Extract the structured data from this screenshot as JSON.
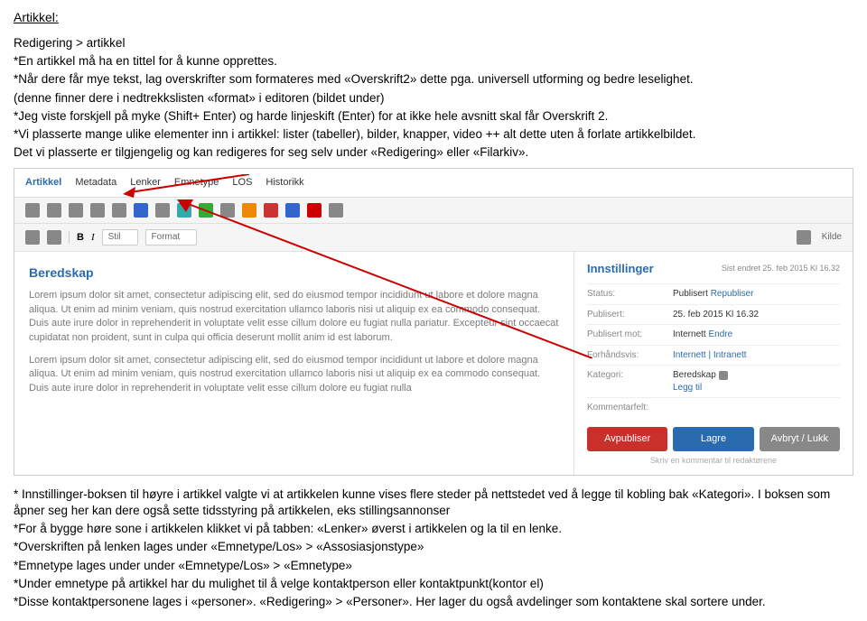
{
  "title": "Artikkel:",
  "intro": [
    "Redigering > artikkel",
    "*En artikkel må ha en tittel for å kunne opprettes.",
    "*Når dere får mye tekst, lag overskrifter som formateres med «Overskrift2» dette pga. universell utforming og bedre leselighet.",
    "(denne finner dere i nedtrekkslisten «format» i editoren (bildet under)",
    "*Jeg viste forskjell på myke (Shift+ Enter) og harde linjeskift (Enter) for at ikke hele avsnitt skal får Overskrift 2.",
    "*Vi plasserte mange ulike elementer inn i artikkel: lister (tabeller), bilder, knapper, video ++ alt dette uten å forlate artikkelbildet.",
    " Det vi plasserte er tilgjengelig og kan redigeres for seg selv under «Redigering» eller «Filarkiv»."
  ],
  "tabs": [
    "Artikkel",
    "Metadata",
    "Lenker",
    "Emnetype",
    "LOS",
    "Historikk"
  ],
  "toolbar2": {
    "b": "B",
    "i": "I",
    "sel1": "Stil",
    "sel2": "Format",
    "kilde": "Kilde"
  },
  "editor": {
    "heading": "Beredskap",
    "p1": "Lorem ipsum dolor sit amet, consectetur adipiscing elit, sed do eiusmod tempor incididunt ut labore et dolore magna aliqua. Ut enim ad minim veniam, quis nostrud exercitation ullamco laboris nisi ut aliquip ex ea commodo consequat. Duis aute irure dolor in reprehenderit in voluptate velit esse cillum dolore eu fugiat nulla pariatur. Excepteur sint occaecat cupidatat non proident, sunt in culpa qui officia deserunt mollit anim id est laborum.",
    "p2": "Lorem ipsum dolor sit amet, consectetur adipiscing elit, sed do eiusmod tempor incididunt ut labore et dolore magna aliqua. Ut enim ad minim veniam, quis nostrud exercitation ullamco laboris nisi ut aliquip ex ea commodo consequat. Duis aute irure dolor in reprehenderit in voluptate velit esse cillum dolore eu fugiat nulla"
  },
  "side": {
    "title": "Innstillinger",
    "sub": "Sist endret 25. feb 2015 Kl 16.32",
    "rows": [
      {
        "k": "Status:",
        "v": "Publisert",
        "link": "Republiser"
      },
      {
        "k": "Publisert:",
        "v": "25. feb 2015 Kl 16.32"
      },
      {
        "k": "Publisert mot:",
        "v": "Internett",
        "link": "Endre"
      },
      {
        "k": "Forhåndsvis:",
        "link": "Internett | Intranett"
      },
      {
        "k": "Kategori:",
        "v": "Beredskap",
        "extra": "Legg til",
        "icon": true
      },
      {
        "k": "Kommentarfelt:",
        "v": ""
      }
    ],
    "buttons": [
      "Avpubliser",
      "Lagre",
      "Avbryt / Lukk"
    ],
    "foot": "Skriv en kommentar til redaktørene"
  },
  "outro": [
    "* Innstillinger-boksen til høyre i artikkel valgte vi at artikkelen kunne vises flere steder på nettstedet ved å legge til kobling bak «Kategori». I boksen som åpner seg her kan dere også sette tidsstyring på artikkelen, eks stillingsannonser",
    "   *For å bygge høre sone i artikkelen klikket vi på tabben: «Lenker» øverst i artikkelen og la til en lenke.",
    " *Overskriften på lenken lages under «Emnetype/Los» > «Assosiasjonstype»",
    " *Emnetype lages under under «Emnetype/Los» > «Emnetype»",
    " *Under emnetype på artikkel har du mulighet til å velge kontaktperson eller kontaktpunkt(kontor el)",
    " *Disse kontaktpersonene lages i «personer». «Redigering» > «Personer».  Her lager du også avdelinger som kontaktene skal sortere under."
  ]
}
